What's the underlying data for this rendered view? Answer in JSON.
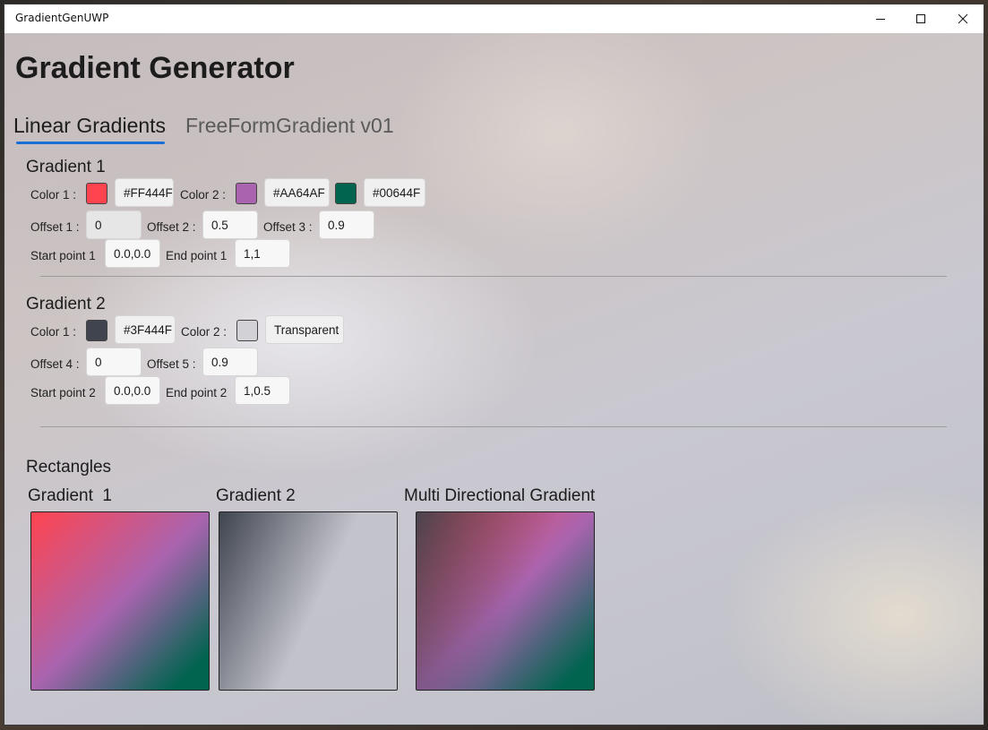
{
  "window": {
    "title": "GradientGenUWP",
    "controls": {
      "minimize": "minimize-icon",
      "maximize": "maximize-icon",
      "close": "close-icon"
    }
  },
  "page": {
    "title": "Gradient Generator"
  },
  "tabs": [
    {
      "label": "Linear Gradients",
      "selected": true
    },
    {
      "label": "FreeFormGradient v01",
      "selected": false
    }
  ],
  "gradient1": {
    "title": "Gradient 1",
    "color1": {
      "label": "Color 1 :",
      "swatch": "#FF444F",
      "value": "#FF444F"
    },
    "color2": {
      "label": "Color 2 :",
      "swatch": "#AA64AF",
      "value": "#AA64AF"
    },
    "color3": {
      "swatch": "#00644F",
      "value": "#00644F"
    },
    "offset1": {
      "label": "Offset 1 :",
      "value": "0"
    },
    "offset2": {
      "label": "Offset 2 :",
      "value": "0.5"
    },
    "offset3": {
      "label": "Offset 3 :",
      "value": "0.9"
    },
    "start": {
      "label": "Start point 1",
      "value": "0.0,0.0"
    },
    "end": {
      "label": "End point 1",
      "value": "1,1"
    }
  },
  "gradient2": {
    "title": "Gradient 2",
    "color1": {
      "label": "Color 1 :",
      "swatch": "#3F444F",
      "value": "#3F444F"
    },
    "color2": {
      "label": "Color 2 :",
      "swatch": "#D2D2D6",
      "value": "Transparent"
    },
    "offset4": {
      "label": "Offset 4 :",
      "value": "0"
    },
    "offset5": {
      "label": "Offset 5 :",
      "value": "0.9"
    },
    "start": {
      "label": "Start point 2",
      "value": "0.0,0.0"
    },
    "end": {
      "label": "End point 2",
      "value": "1,0.5"
    }
  },
  "rectangles": {
    "title": "Rectangles",
    "items": [
      {
        "label": "Gradient  1"
      },
      {
        "label": "Gradient 2"
      },
      {
        "label": "Multi Directional Gradient"
      }
    ]
  }
}
